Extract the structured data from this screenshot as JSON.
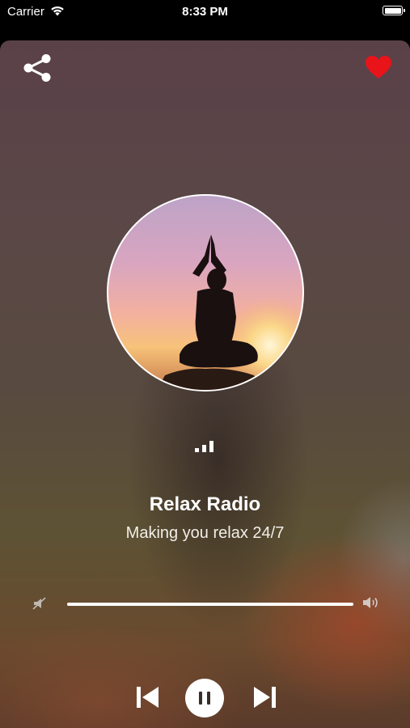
{
  "status_bar": {
    "carrier": "Carrier",
    "time": "8:33 PM",
    "battery_percent": 100
  },
  "player": {
    "station_name": "Relax Radio",
    "station_tagline": "Making you relax 24/7",
    "volume_fraction": 1.0,
    "playback_state": "playing",
    "favorite": true
  },
  "icons": {
    "share": "share-icon",
    "favorite": "heart-icon",
    "signal": "signal-bars-icon",
    "volume_min": "volume-mute-icon",
    "volume_max": "volume-up-icon",
    "previous": "skip-previous-icon",
    "pause": "pause-icon",
    "next": "skip-next-icon"
  },
  "colors": {
    "heart": "#e8141a",
    "control": "#ffffff"
  }
}
